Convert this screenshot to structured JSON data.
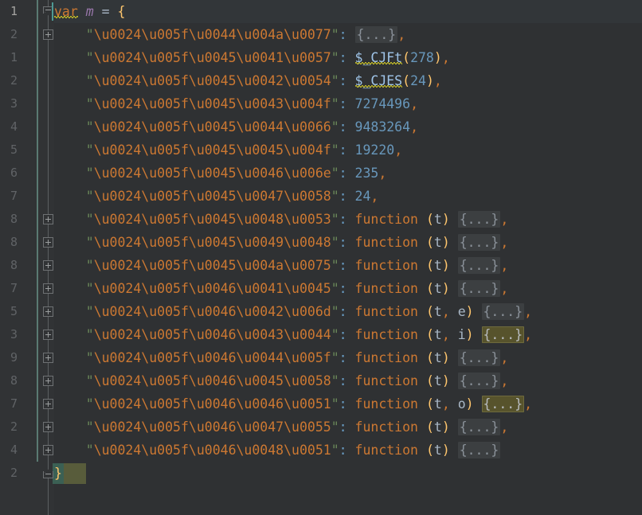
{
  "editor": {
    "theme": "darcula",
    "background": "#2f3133",
    "gutter_background": "#313335",
    "current_line_background": "#323639",
    "caret_color": "#4e9a94",
    "font_size_px": 16.5,
    "line_height_px": 29,
    "colors": {
      "keyword": "#cc7832",
      "identifier": "#9876aa",
      "string_quote": "#6a8759",
      "escape_sequence": "#cc7832",
      "number": "#6897bb",
      "brace": "#ffc66d",
      "paren": "#ffc66d",
      "colon": "#6a9ec6",
      "comma": "#cc7832",
      "function_call": "#9fc4e8",
      "default_text": "#a9b7c6",
      "folded_background": "#3c3f41",
      "folded_highlight_background": "#57532c",
      "warning_squiggle": "#bbb529"
    }
  },
  "gutter": {
    "line_numbers": [
      "1",
      "2",
      "1",
      "2",
      "3",
      "4",
      "5",
      "6",
      "7",
      "8",
      "8",
      "8",
      "7",
      "5",
      "3",
      "9",
      "8",
      "7",
      "2",
      "4",
      "2"
    ],
    "fold_markers": [
      {
        "row": 0,
        "type": "region-start"
      },
      {
        "row": 1,
        "type": "plus"
      },
      {
        "row": 9,
        "type": "plus"
      },
      {
        "row": 10,
        "type": "plus"
      },
      {
        "row": 11,
        "type": "plus"
      },
      {
        "row": 12,
        "type": "plus"
      },
      {
        "row": 13,
        "type": "plus"
      },
      {
        "row": 14,
        "type": "plus"
      },
      {
        "row": 15,
        "type": "plus"
      },
      {
        "row": 16,
        "type": "plus"
      },
      {
        "row": 17,
        "type": "plus"
      },
      {
        "row": 18,
        "type": "plus"
      },
      {
        "row": 19,
        "type": "plus"
      },
      {
        "row": 20,
        "type": "region-end"
      }
    ]
  },
  "code": {
    "declaration": {
      "keyword": "var",
      "identifier": "m",
      "operator": "=",
      "open_brace": "{"
    },
    "close_brace": "}",
    "indent": "    ",
    "properties": [
      {
        "key": "\"\\u0024\\u005f\\u0044\\u004a\\u0077\"",
        "value_kind": "folded-object",
        "value": "{...}",
        "highlight": false,
        "trailing_comma": ","
      },
      {
        "key": "\"\\u0024\\u005f\\u0045\\u0041\\u0057\"",
        "value_kind": "call",
        "callee": "$_CJFt",
        "arg": "278",
        "trailing_comma": ","
      },
      {
        "key": "\"\\u0024\\u005f\\u0045\\u0042\\u0054\"",
        "value_kind": "call",
        "callee": "$_CJES",
        "arg": "24",
        "trailing_comma": ","
      },
      {
        "key": "\"\\u0024\\u005f\\u0045\\u0043\\u004f\"",
        "value_kind": "number",
        "value": "7274496",
        "trailing_comma": ","
      },
      {
        "key": "\"\\u0024\\u005f\\u0045\\u0044\\u0066\"",
        "value_kind": "number",
        "value": "9483264",
        "trailing_comma": ","
      },
      {
        "key": "\"\\u0024\\u005f\\u0045\\u0045\\u004f\"",
        "value_kind": "number",
        "value": "19220",
        "trailing_comma": ","
      },
      {
        "key": "\"\\u0024\\u005f\\u0045\\u0046\\u006e\"",
        "value_kind": "number",
        "value": "235",
        "trailing_comma": ","
      },
      {
        "key": "\"\\u0024\\u005f\\u0045\\u0047\\u0058\"",
        "value_kind": "number",
        "value": "24",
        "trailing_comma": ","
      },
      {
        "key": "\"\\u0024\\u005f\\u0045\\u0048\\u0053\"",
        "value_kind": "function",
        "params": "t",
        "value": "{...}",
        "highlight": false,
        "trailing_comma": ","
      },
      {
        "key": "\"\\u0024\\u005f\\u0045\\u0049\\u0048\"",
        "value_kind": "function",
        "params": "t",
        "value": "{...}",
        "highlight": false,
        "trailing_comma": ","
      },
      {
        "key": "\"\\u0024\\u005f\\u0045\\u004a\\u0075\"",
        "value_kind": "function",
        "params": "t",
        "value": "{...}",
        "highlight": false,
        "trailing_comma": ","
      },
      {
        "key": "\"\\u0024\\u005f\\u0046\\u0041\\u0045\"",
        "value_kind": "function",
        "params": "t",
        "value": "{...}",
        "highlight": false,
        "trailing_comma": ","
      },
      {
        "key": "\"\\u0024\\u005f\\u0046\\u0042\\u006d\"",
        "value_kind": "function",
        "params": "t, e",
        "value": "{...}",
        "highlight": false,
        "trailing_comma": ","
      },
      {
        "key": "\"\\u0024\\u005f\\u0046\\u0043\\u0044\"",
        "value_kind": "function",
        "params": "t, i",
        "value": "{...}",
        "highlight": true,
        "trailing_comma": ","
      },
      {
        "key": "\"\\u0024\\u005f\\u0046\\u0044\\u005f\"",
        "value_kind": "function",
        "params": "t",
        "value": "{...}",
        "highlight": false,
        "trailing_comma": ","
      },
      {
        "key": "\"\\u0024\\u005f\\u0046\\u0045\\u0058\"",
        "value_kind": "function",
        "params": "t",
        "value": "{...}",
        "highlight": false,
        "trailing_comma": ","
      },
      {
        "key": "\"\\u0024\\u005f\\u0046\\u0046\\u0051\"",
        "value_kind": "function",
        "params": "t, o",
        "value": "{...}",
        "highlight": true,
        "trailing_comma": ","
      },
      {
        "key": "\"\\u0024\\u005f\\u0046\\u0047\\u0055\"",
        "value_kind": "function",
        "params": "t",
        "value": "{...}",
        "highlight": false,
        "trailing_comma": ","
      },
      {
        "key": "\"\\u0024\\u005f\\u0046\\u0048\\u0051\"",
        "value_kind": "function",
        "params": "t",
        "value": "{...}",
        "highlight": false,
        "trailing_comma": ""
      }
    ],
    "function_keyword": "function",
    "open_paren": "(",
    "close_paren": ")"
  }
}
